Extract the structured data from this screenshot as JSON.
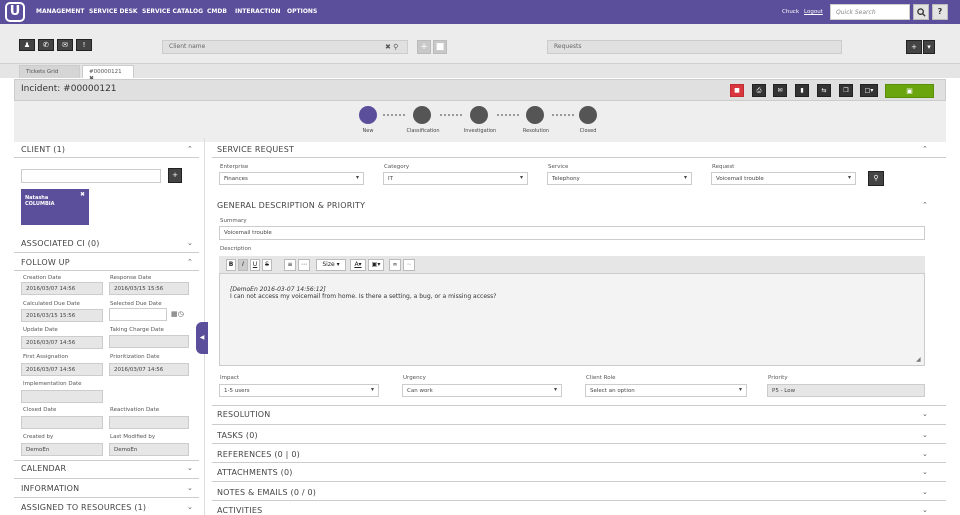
{
  "topnav": {
    "logo": "U",
    "menu": [
      "MANAGEMENT",
      "SERVICE DESK",
      "SERVICE CATALOG",
      "CMDB",
      "INTERACTION",
      "OPTIONS"
    ],
    "user": "Chuck",
    "logout": "Logout",
    "search_placeholder": "Quick Search",
    "search_icon": "search-icon",
    "help": "?"
  },
  "toolbar2": {
    "client_placeholder": "Client name",
    "requests_placeholder": "Requests",
    "plus": "+"
  },
  "tabs": [
    {
      "label": "Tickets Grid"
    },
    {
      "label": "#00000121"
    }
  ],
  "incident": {
    "title": "Incident: #00000121"
  },
  "workflow": [
    "New",
    "Classification",
    "Investigation",
    "Resolution",
    "Closed"
  ],
  "left": {
    "client_title": "CLIENT (1)",
    "client_card": {
      "first": "Natasha",
      "last": "COLUMBIA"
    },
    "associated_ci": "ASSOCIATED CI (0)",
    "follow_up": "FOLLOW UP",
    "fields": [
      {
        "label": "Creation Date",
        "value": "2016/03/07 14:56"
      },
      {
        "label": "Response Date",
        "value": "2016/03/15 15:56"
      },
      {
        "label": "Calculated Due Date",
        "value": "2016/03/15 15:56"
      },
      {
        "label": "Selected Due Date",
        "value": ""
      },
      {
        "label": "Update Date",
        "value": "2016/03/07 14:56"
      },
      {
        "label": "Taking Charge Date",
        "value": ""
      },
      {
        "label": "First Assignation",
        "value": "2016/03/07 14:56"
      },
      {
        "label": "Prioritization Date",
        "value": "2016/03/07 14:56"
      },
      {
        "label": "Implementation Date",
        "value": ""
      },
      {
        "label": "Closed Date",
        "value": ""
      },
      {
        "label": "Reactivation Date",
        "value": ""
      },
      {
        "label": "Created by",
        "value": "DemoEn"
      },
      {
        "label": "Last Modified by",
        "value": "DemoEn"
      }
    ],
    "calendar": "CALENDAR",
    "information": "INFORMATION",
    "assigned": "ASSIGNED TO RESOURCES (1)"
  },
  "main": {
    "service_request": "SERVICE REQUEST",
    "enterprise": {
      "label": "Enterprise",
      "value": "Finances"
    },
    "category": {
      "label": "Category",
      "value": "IT"
    },
    "service": {
      "label": "Service",
      "value": "Telephony"
    },
    "request": {
      "label": "Request",
      "value": "Voicemail trouble"
    },
    "gen_desc": "GENERAL DESCRIPTION & PRIORITY",
    "summary_label": "Summary",
    "summary_value": "Voicemail trouble",
    "description_label": "Description",
    "editor": {
      "size": "Size",
      "line1": "[DemoEn 2016-03-07 14:56:12]",
      "line2": "I can not access my voicemail from home. Is there a setting, a bug, or a missing access?"
    },
    "impact": {
      "label": "Impact",
      "value": "1-5 users"
    },
    "urgency": {
      "label": "Urgency",
      "value": "Can work"
    },
    "client_role": {
      "label": "Client Role",
      "value": "Select an option"
    },
    "priority": {
      "label": "Priority",
      "value": "P5 - Low"
    },
    "sections": [
      "RESOLUTION",
      "TASKS (0)",
      "REFERENCES (0 | 0)",
      "ATTACHMENTS (0)",
      "NOTES & EMAILS (0 / 0)",
      "ACTIVITIES"
    ]
  },
  "colors": {
    "brand": "#5b4e9b",
    "save": "#6aa50d",
    "delete": "#d9363e"
  }
}
